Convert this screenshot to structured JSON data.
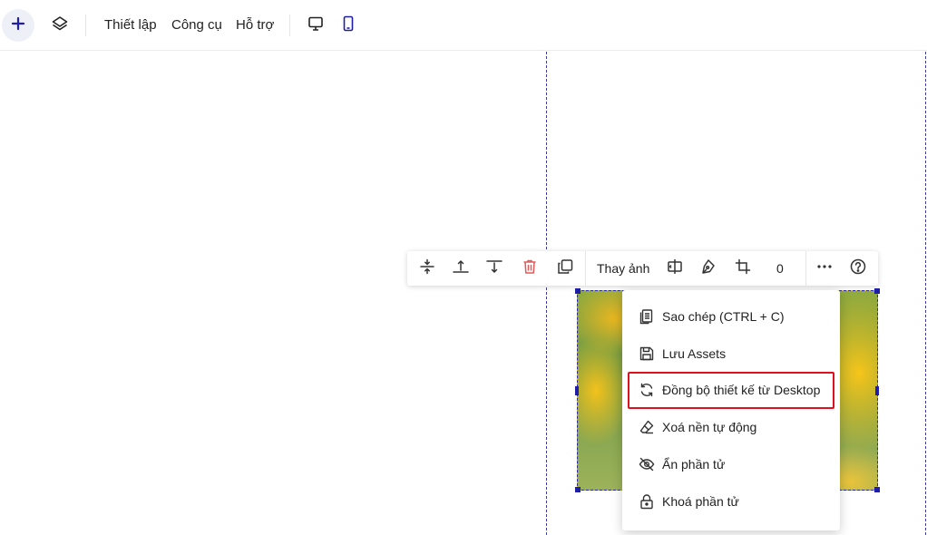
{
  "colors": {
    "accent": "#1e1ea8",
    "highlight": "#e0101e",
    "delete": "#e05a5a"
  },
  "topbar": {
    "add_icon": "plus-icon",
    "layers_icon": "layers-icon",
    "menu": [
      "Thiết lập",
      "Công cụ",
      "Hỗ trợ"
    ],
    "desktop_icon": "desktop-icon",
    "mobile_icon": "mobile-icon"
  },
  "toolbar": {
    "icons": [
      "align-center-icon",
      "align-top-icon",
      "align-bottom-icon",
      "delete-icon",
      "duplicate-icon"
    ],
    "replace_image": "Thay ảnh",
    "icons2": [
      "flip-icon",
      "pen-icon",
      "crop-icon"
    ],
    "value": "0",
    "more_icon": "more-icon",
    "help_icon": "help-icon"
  },
  "context_menu": {
    "items": [
      {
        "label": "Sao chép (CTRL + C)",
        "icon": "copy-icon"
      },
      {
        "label": "Lưu Assets",
        "icon": "save-icon"
      },
      {
        "label": "Đồng bộ thiết kế từ Desktop",
        "icon": "sync-icon"
      },
      {
        "label": "Xoá nền tự động",
        "icon": "eraser-icon"
      },
      {
        "label": "Ẩn phần tử",
        "icon": "eye-off-icon"
      },
      {
        "label": "Khoá phần tử",
        "icon": "lock-icon"
      }
    ]
  }
}
